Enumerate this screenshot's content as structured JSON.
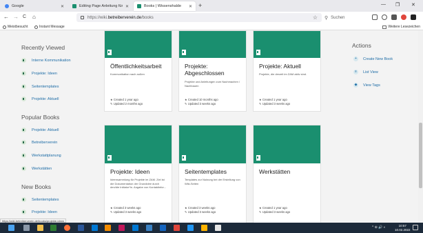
{
  "browser": {
    "tabs": [
      {
        "title": "Google",
        "favicon_color": "#4285f4",
        "active": false
      },
      {
        "title": "Editing Page Anleitung für das",
        "favicon_color": "#1a8f6f",
        "active": false
      },
      {
        "title": "Books | Wissenshalde",
        "favicon_color": "#1a8f6f",
        "active": true
      }
    ],
    "new_tab": "+",
    "window_controls": [
      "—",
      "❐",
      "✕"
    ],
    "nav": {
      "back": "←",
      "forward": "→",
      "reload": "C",
      "home": "⌂"
    },
    "url_prefix": "https://wiki.",
    "url_host": "betreiberverein.de",
    "url_path": "/books",
    "star": "☆",
    "search_placeholder": "Suchen",
    "bookmarks": [
      "Meistbesucht",
      "Instant Message"
    ],
    "other_bookmarks": "Weitere Lesezeichen",
    "status_url": "https://wiki.betreiberverein.de/books/projekte-ideen"
  },
  "sidebar": {
    "recently_viewed_title": "Recently Viewed",
    "recently_viewed": [
      "Interne Kommunikation",
      "Projekte: Ideen",
      "Seitentemplates",
      "Projekte: Aktuell"
    ],
    "popular_title": "Popular Books",
    "popular": [
      "Projekte: Aktuell",
      "Betreiberverein",
      "Werkstattplanung",
      "Werkstätten"
    ],
    "new_title": "New Books",
    "new": [
      "Seitentemplates",
      "Projekte: Ideen"
    ]
  },
  "books": [
    {
      "title": "Öffentlichkeitsarbeit",
      "description": "Kommunikation nach außen",
      "created": "Created 1 year ago",
      "updated": "Updated 2 months ago"
    },
    {
      "title": "Projekte: Abgeschlossen",
      "description": "Projekte und Anleitungen zum Nachmachen / Nachbauen",
      "created": "Created 10 months ago",
      "updated": "Updated 3 weeks ago"
    },
    {
      "title": "Projekte: Aktuell",
      "description": "Projekte, die derzeit im ZAM aktiv sind.",
      "created": "Created 1 year ago",
      "updated": "Updated 3 weeks ago"
    },
    {
      "title": "Projekte: Ideen",
      "description": "Ideensammlung für Projekte im ZAM. Ziel ist die Dokumentation der Grundidee durch den/die Initiator*in. Angabe von Kontaktinfor...",
      "created": "Created 3 weeks ago",
      "updated": "Updated 3 weeks ago"
    },
    {
      "title": "Seitentemplates",
      "description": "Templates zur Nutzung bei der Erstellung von Wiki-Seiten",
      "created": "Created 3 weeks ago",
      "updated": "Updated 3 weeks ago"
    },
    {
      "title": "Werkstätten",
      "description": "",
      "created": "Created 1 year ago",
      "updated": "Updated 3 weeks ago"
    }
  ],
  "actions": {
    "title": "Actions",
    "items": [
      {
        "label": "Create New Book",
        "icon": "+"
      },
      {
        "label": "List View",
        "icon": "≡"
      },
      {
        "label": "View Tags",
        "icon": "◆"
      }
    ]
  },
  "taskbar": {
    "time": "10:57",
    "date": "10.02.2022",
    "tray": "^ ⊕ 🔊 ◐"
  },
  "colors": {
    "accent": "#1a8f6f",
    "link": "#206ea7",
    "taskbar": "#1c2a3a"
  }
}
